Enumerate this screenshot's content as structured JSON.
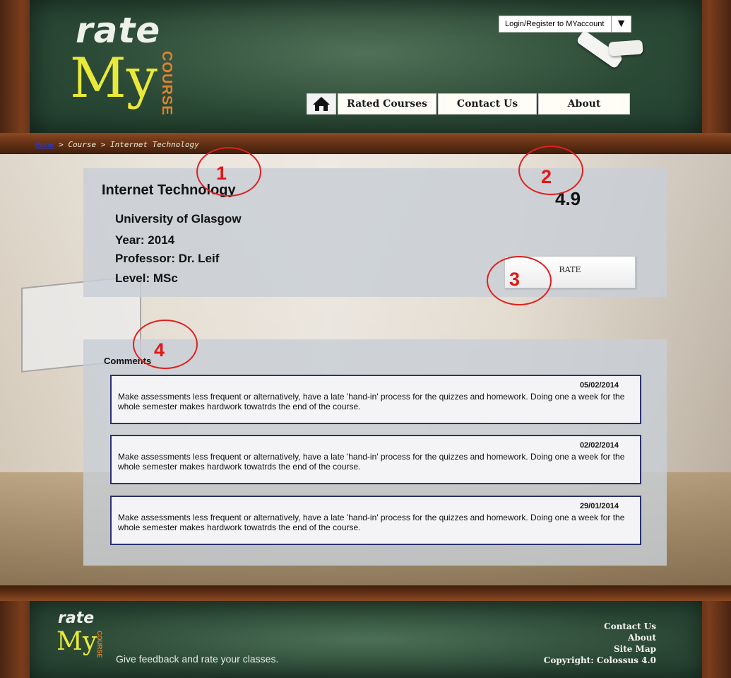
{
  "header": {
    "logo": {
      "rate": "rate",
      "my": "My",
      "course": "COURSE"
    },
    "login_label": "Login/Register to MYaccount",
    "dropdown_glyph": "▼",
    "nav": {
      "home_icon": "home-icon",
      "rated_courses": "Rated Courses",
      "contact_us": "Contact Us",
      "about": "About"
    }
  },
  "breadcrumb": {
    "home": "Home",
    "rest": " > Course > Internet Technology"
  },
  "course": {
    "title": "Internet Technology",
    "university": "University of Glasgow",
    "year": "Year: 2014",
    "professor": "Professor: Dr. Leif",
    "level": "Level: MSc",
    "rating": "4.9",
    "rate_button": "RATE"
  },
  "comments": {
    "heading": "Comments",
    "items": [
      {
        "date": "05/02/2014",
        "text": "Make assessments less frequent or alternatively, have a late 'hand-in' process for the quizzes and homework. Doing one a week for the whole semester makes hardwork towatrds the end of the course."
      },
      {
        "date": "02/02/2014",
        "text": "Make assessments less frequent or alternatively, have a late 'hand-in' process for the quizzes and homework. Doing one a week for the whole semester makes hardwork towatrds the end of the course."
      },
      {
        "date": "29/01/2014",
        "text": "Make assessments less frequent or alternatively, have a late 'hand-in' process for the quizzes and homework. Doing one a week for the whole semester makes hardwork towatrds the end of the course."
      }
    ]
  },
  "annotations": {
    "m1": "1",
    "m2": "2",
    "m3": "3",
    "m4": "4",
    "color": "#e02020"
  },
  "footer": {
    "logo": {
      "rate": "rate",
      "my": "My",
      "course": "COURSE"
    },
    "tagline": "Give feedback and rate your classes.",
    "links": {
      "contact_us": "Contact Us",
      "about": "About",
      "site_map": "Site Map",
      "copyright": "Copyright: Colossus 4.0"
    }
  }
}
